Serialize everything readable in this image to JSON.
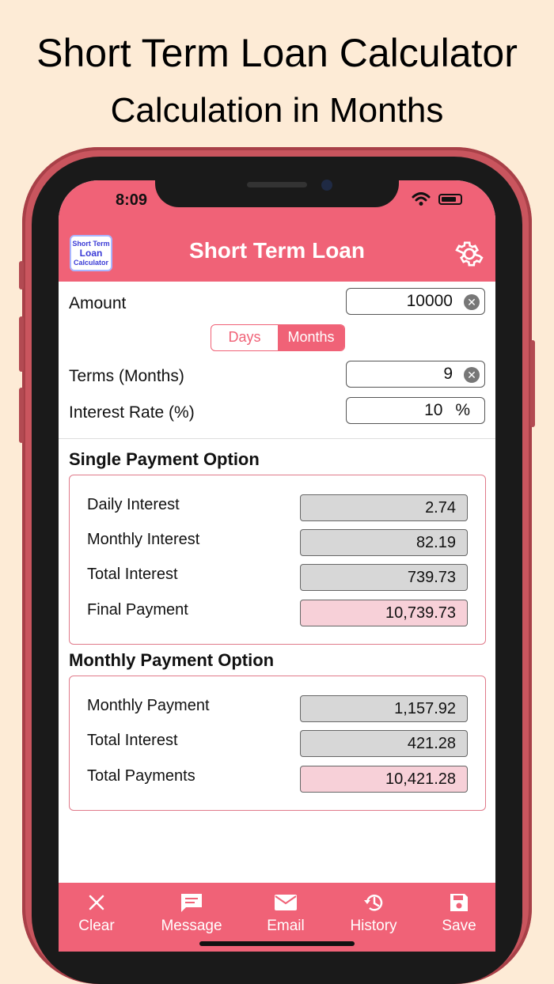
{
  "promo": {
    "title": "Short Term Loan Calculator",
    "subtitle": "Calculation in Months"
  },
  "status": {
    "time": "8:09"
  },
  "header": {
    "logo_line1": "Short Term",
    "logo_line2": "Loan",
    "logo_line3": "Calculator",
    "title": "Short Term Loan"
  },
  "inputs": {
    "amount_label": "Amount",
    "amount_value": "10000",
    "segment_days": "Days",
    "segment_months": "Months",
    "terms_label": "Terms (Months)",
    "terms_value": "9",
    "rate_label": "Interest Rate (%)",
    "rate_value": "10",
    "rate_unit": "%"
  },
  "single": {
    "title": "Single Payment Option",
    "rows": [
      {
        "label": "Daily Interest",
        "value": "2.74"
      },
      {
        "label": "Monthly Interest",
        "value": "82.19"
      },
      {
        "label": "Total Interest",
        "value": "739.73"
      },
      {
        "label": "Final Payment",
        "value": "10,739.73"
      }
    ]
  },
  "monthly": {
    "title": "Monthly Payment Option",
    "rows": [
      {
        "label": "Monthly Payment",
        "value": "1,157.92"
      },
      {
        "label": "Total Interest",
        "value": "421.28"
      },
      {
        "label": "Total Payments",
        "value": "10,421.28"
      }
    ]
  },
  "tabs": [
    {
      "label": "Clear",
      "icon": "close-icon"
    },
    {
      "label": "Message",
      "icon": "message-icon"
    },
    {
      "label": "Email",
      "icon": "email-icon"
    },
    {
      "label": "History",
      "icon": "history-icon"
    },
    {
      "label": "Save",
      "icon": "save-icon"
    }
  ],
  "colors": {
    "accent": "#f06277",
    "background": "#fdebd6",
    "phone": "#c9555e"
  }
}
